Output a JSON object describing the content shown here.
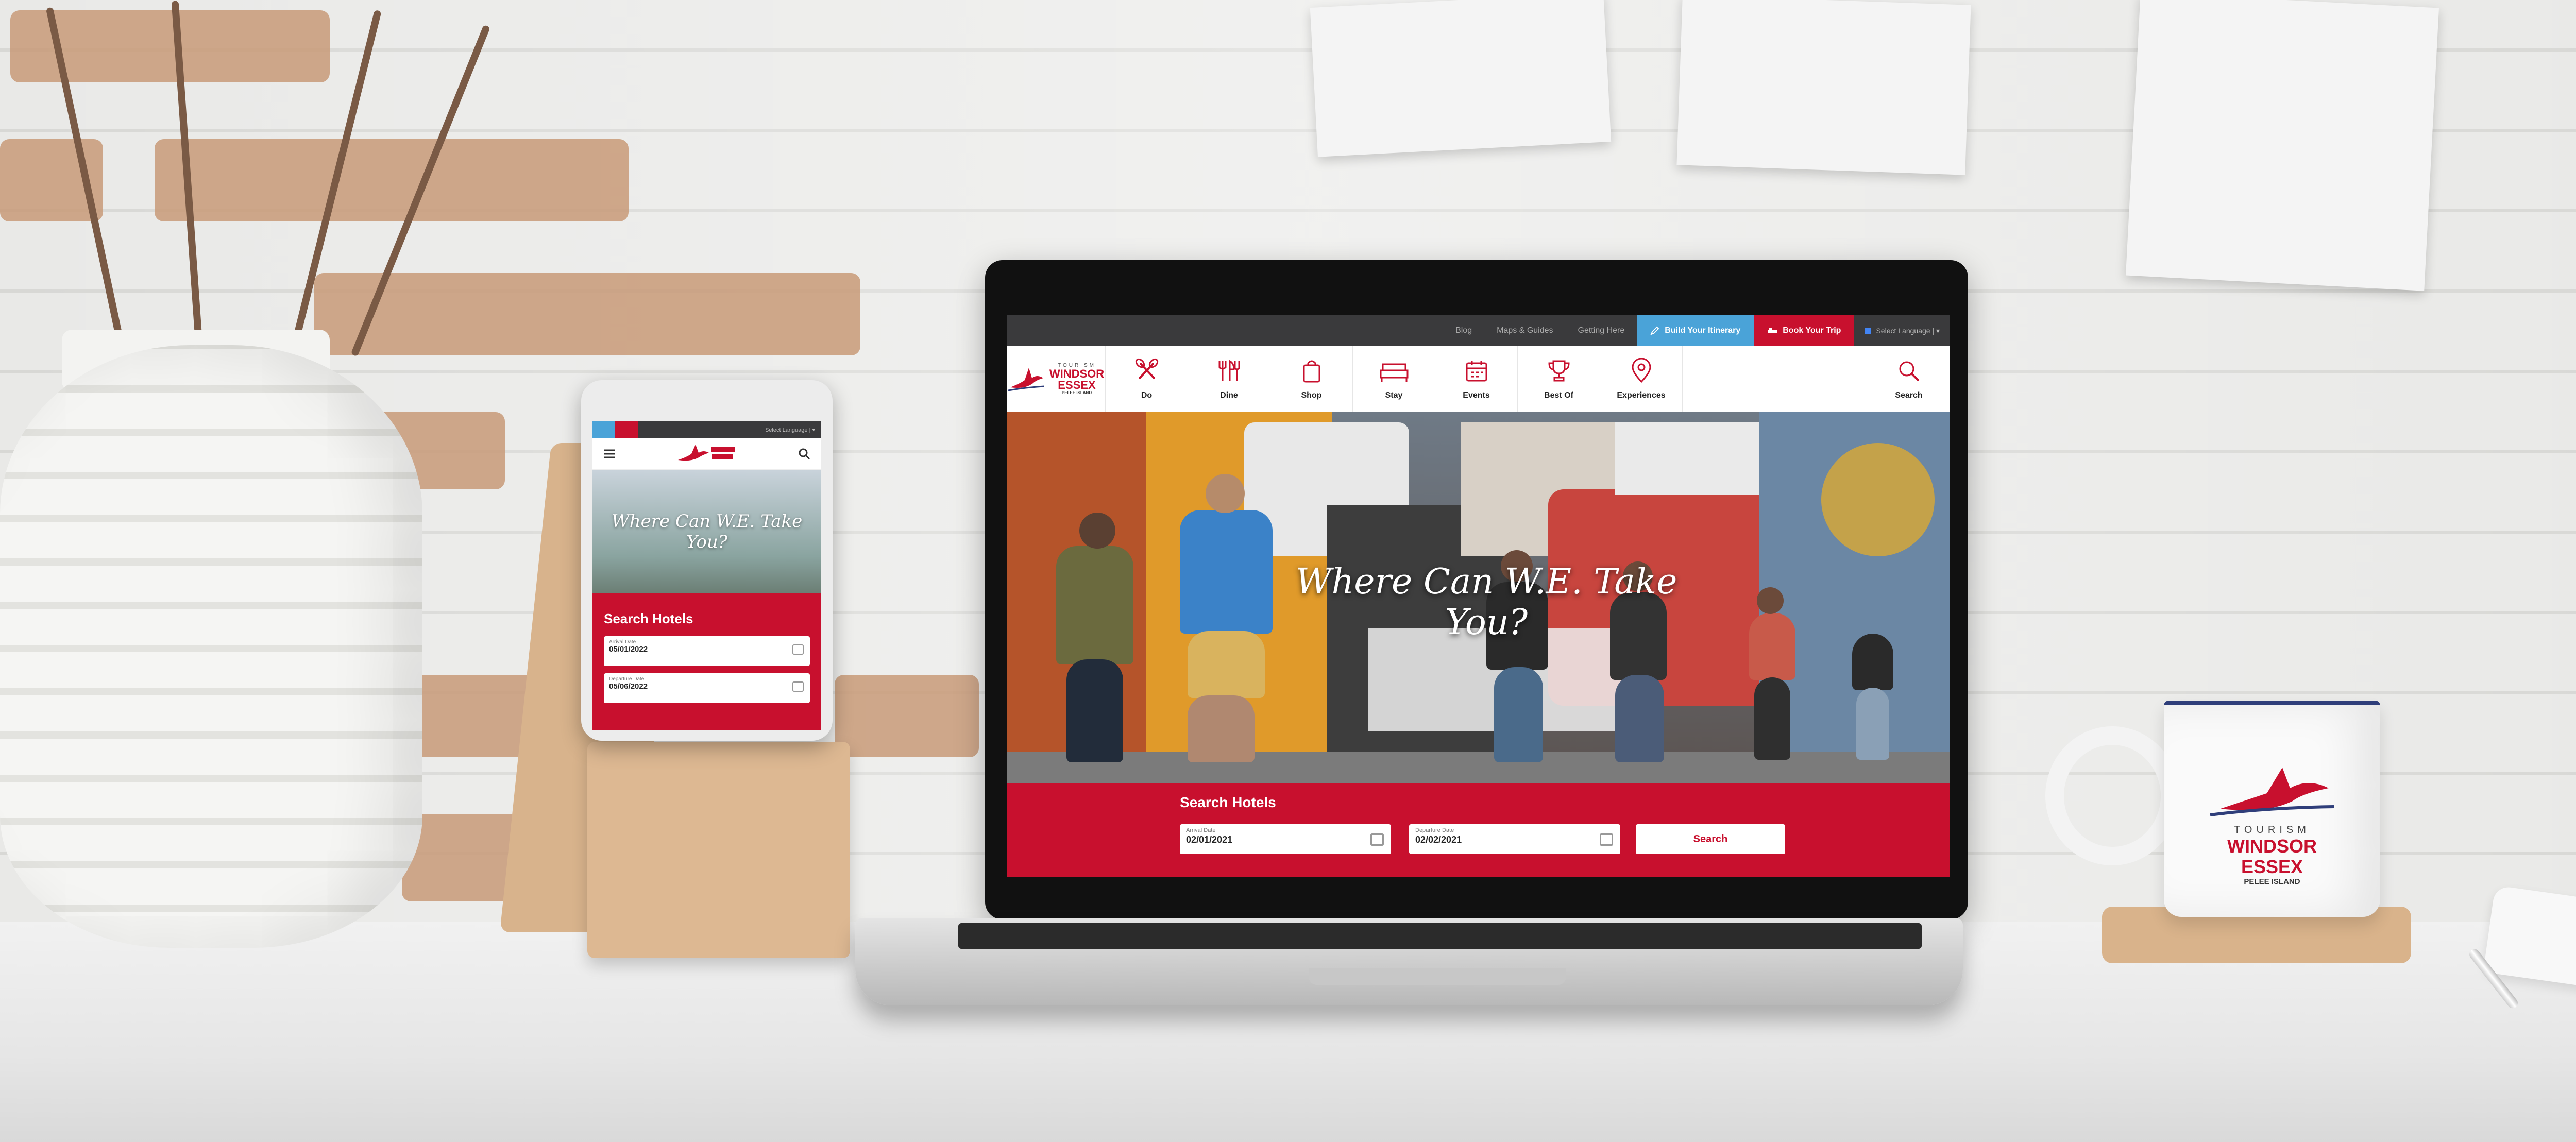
{
  "site": {
    "utility_links": [
      "Blog",
      "Maps & Guides",
      "Getting Here"
    ],
    "itinerary_label": "Build Your Itinerary",
    "book_label": "Book Your Trip",
    "language_label": "Select Language | ▾",
    "logo": {
      "small": "TOURISM",
      "main_1": "WINDSOR",
      "main_2": "ESSEX",
      "sub": "PELEE ISLAND"
    },
    "nav": [
      {
        "label": "Do",
        "icon": "paddles-icon"
      },
      {
        "label": "Dine",
        "icon": "cutlery-icon"
      },
      {
        "label": "Shop",
        "icon": "shopping-bag-icon"
      },
      {
        "label": "Stay",
        "icon": "bed-icon"
      },
      {
        "label": "Events",
        "icon": "calendar-icon"
      },
      {
        "label": "Best Of",
        "icon": "trophy-icon"
      },
      {
        "label": "Experiences",
        "icon": "map-pin-icon"
      }
    ],
    "search_label": "Search",
    "hero_tagline": "Where Can W.E. Take You?",
    "hotel_search": {
      "title": "Search Hotels",
      "arrival_label": "Arrival Date",
      "arrival_value": "02/01/2021",
      "departure_label": "Departure Date",
      "departure_value": "02/02/2021",
      "button_label": "Search"
    }
  },
  "phone": {
    "language_label": "Select Language | ▾",
    "hero_tagline": "Where Can W.E. Take You?",
    "search_title": "Search Hotels",
    "arrival_label": "Arrival Date",
    "arrival_value": "05/01/2022",
    "departure_label": "Departure Date",
    "departure_value": "05/06/2022"
  },
  "mug_logo": {
    "small": "TOURISM",
    "main_1": "WINDSOR",
    "main_2": "ESSEX",
    "sub": "PELEE ISLAND"
  },
  "colors": {
    "brand_red": "#c8102e",
    "itinerary_blue": "#4aa3d8",
    "topbar": "#3a3a3c"
  }
}
